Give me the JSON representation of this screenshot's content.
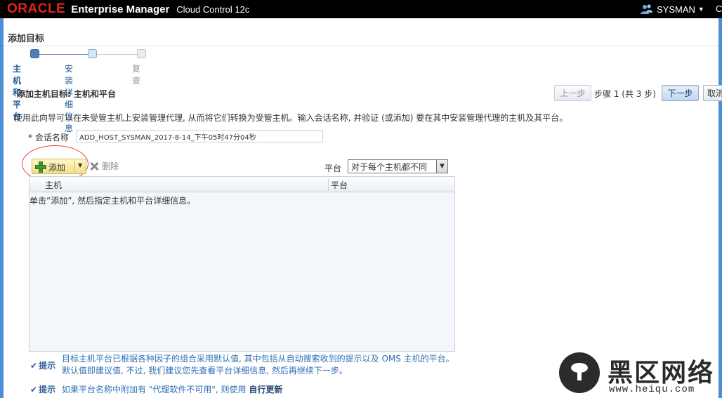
{
  "header": {
    "logo": "ORACLE",
    "product": "Enterprise Manager",
    "product_sub": "Cloud Control 12c",
    "user": "SYSMAN",
    "user_more": "C"
  },
  "page": {
    "title": "添加目标"
  },
  "train": {
    "steps": [
      {
        "label": "主机和平台",
        "state": "current"
      },
      {
        "label": "安装详细信息",
        "state": "next"
      },
      {
        "label": "复查",
        "state": "disabled"
      }
    ]
  },
  "section": {
    "title": "添加主机目标: 主机和平台",
    "back_label": "上一步",
    "step_text": "步骤 1 (共 3 步)",
    "next_label": "下一步",
    "cancel_label": "取消"
  },
  "instruction": "使用此向导可以在未受管主机上安装管理代理, 从而将它们转换为受管主机。输入会话名称, 并验证 (或添加) 要在其中安装管理代理的主机及其平台。",
  "session": {
    "label": "* 会话名称",
    "value": "ADD_HOST_SYSMAN_2017-8-14_下午05时47分04秒"
  },
  "toolbar": {
    "add_label": "添加",
    "delete_label": "删除",
    "platform_label": "平台",
    "platform_value": "对于每个主机都不同"
  },
  "table": {
    "columns": [
      "主机",
      "平台"
    ],
    "empty_message": "单击“添加”, 然后指定主机和平台详细信息。"
  },
  "hints": [
    {
      "tag": "提示",
      "text": "目标主机平台已根据各种因子的组合采用默认值, 其中包括从自动搜索收到的提示以及 OMS 主机的平台。默认值即建议值, 不过, 我们建议您先查看平台详细信息, 然后再继续下一步。"
    },
    {
      "tag": "提示",
      "text": "如果平台名称中附加有 \"代理软件不可用\", 则使用 ",
      "emphasis": "自行更新"
    }
  ],
  "watermark": {
    "title": "黑区网络",
    "url": "www.heiqu.com"
  },
  "colors": {
    "accent": "#4c8fd5",
    "oracle_red": "#e2231a",
    "link_blue": "#2e6fb5",
    "highlight_ellipse": "#e0484e"
  }
}
